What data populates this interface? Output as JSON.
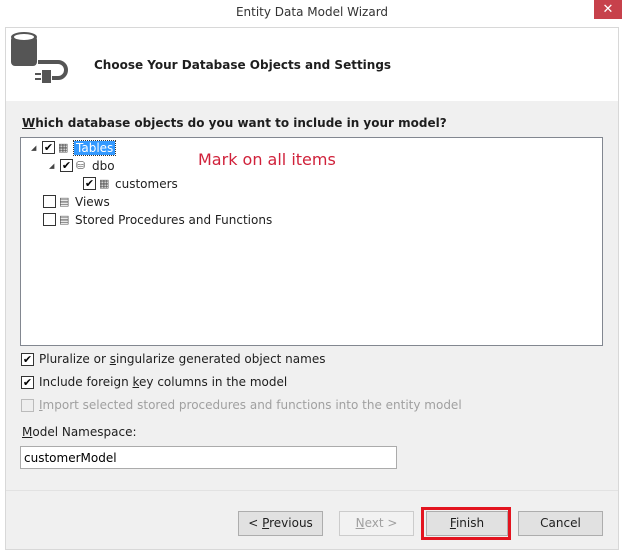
{
  "window": {
    "title": "Entity Data Model Wizard",
    "close": "✕"
  },
  "header": {
    "title": "Choose Your Database Objects and Settings"
  },
  "question": {
    "accel": "W",
    "rest": "hich database objects do you want to include in your model?"
  },
  "tree": [
    {
      "label": "Tables",
      "checked": true
    },
    {
      "label": "dbo",
      "checked": true
    },
    {
      "label": "customers",
      "checked": true
    },
    {
      "label": "Views",
      "checked": false
    },
    {
      "label": "Stored Procedures and Functions",
      "checked": false
    }
  ],
  "annotation": "Mark on all items",
  "options": {
    "pluralize": {
      "a": "Pluralize or ",
      "k": "s",
      "b": "ingularize generated object names",
      "checked": true
    },
    "foreign_keys": {
      "a": "Include foreign ",
      "k": "k",
      "b": "ey columns in the model",
      "checked": true
    },
    "import_sp": {
      "a": "",
      "k": "I",
      "b": "mport selected stored procedures and functions into the entity model",
      "checked": false,
      "disabled": true
    }
  },
  "namespace": {
    "accel": "M",
    "rest": "odel Namespace:",
    "value": "customerModel"
  },
  "buttons": {
    "previous": {
      "a": "< ",
      "k": "P",
      "b": "revious"
    },
    "next": {
      "a": "",
      "k": "N",
      "b": "ext >"
    },
    "finish": {
      "a": "",
      "k": "F",
      "b": "inish"
    },
    "cancel": "Cancel"
  },
  "colors": {
    "highlight": "#e3141f",
    "annotation": "#d0213a",
    "selection": "#3399ff"
  }
}
